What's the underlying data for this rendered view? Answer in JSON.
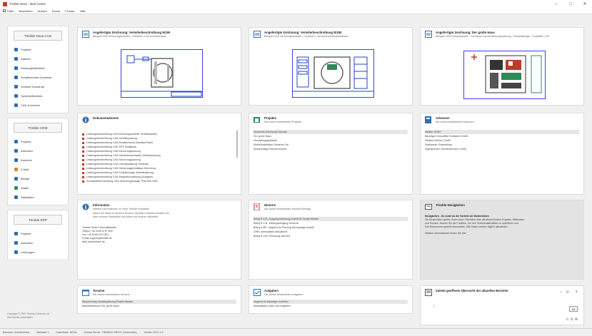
{
  "window": {
    "title": "Trimble Nova - Start Center",
    "minimize_glyph": "–",
    "maximize_glyph": "□",
    "close_glyph": "✕"
  },
  "menu": [
    "Datei",
    "Bearbeiten",
    "Ansicht",
    "Extras",
    "Fenster",
    "Hilfe"
  ],
  "sidebar": {
    "groups": [
      {
        "header": "Trimble Nova CAD",
        "items": [
          {
            "label": "Projekte",
            "icon": "folder-icon",
            "color": "blue"
          },
          {
            "label": "Dateien",
            "icon": "file-icon",
            "color": "blue"
          },
          {
            "label": "Planungsbibliothek",
            "icon": "library-icon",
            "color": "blue"
          },
          {
            "label": "Schaltschrank-Konstrukt",
            "icon": "cabinet-icon",
            "color": "blue"
          },
          {
            "label": "Verteiler-Konstrukt",
            "icon": "distributor-icon",
            "color": "blue"
          },
          {
            "label": "Symbolbibliothek",
            "icon": "symbol-icon",
            "color": "blue"
          },
          {
            "label": "CAD-Konverter",
            "icon": "converter-icon",
            "color": "blue"
          }
        ]
      },
      {
        "header": "Trimble CRM",
        "items": [
          {
            "label": "Projekte",
            "icon": "folder-icon",
            "color": "blue"
          },
          {
            "label": "Adressen",
            "icon": "address-icon",
            "color": "blue"
          },
          {
            "label": "Kalender",
            "icon": "calendar-icon",
            "color": "blue"
          },
          {
            "label": "E-Mail",
            "icon": "mail-icon",
            "color": "orange"
          },
          {
            "label": "Belege",
            "icon": "receipt-icon",
            "color": "blue"
          },
          {
            "label": "Artikel",
            "icon": "article-icon",
            "color": "green"
          },
          {
            "label": "Statistiken",
            "icon": "statistics-icon",
            "color": "blue"
          }
        ]
      },
      {
        "header": "Trimble ERP",
        "items": [
          {
            "label": "Projekte",
            "icon": "folder-icon",
            "color": "blue"
          },
          {
            "label": "Adressen",
            "icon": "address-icon",
            "color": "blue"
          },
          {
            "label": "Leistungen",
            "icon": "services-icon",
            "color": "blue"
          }
        ]
      }
    ],
    "footer": [
      "Copyright © 2021 Trimble Solutions Ltd.",
      "Alle Rechte vorbehalten."
    ]
  },
  "tiles": {
    "drawing1": {
      "title": "Angefertigte Zeichnung: Verteilerbeschreibung W150",
      "sub": "Beispiel CAD-Wohnungsverteiler - Gebäude 1 mit Schaltschrank"
    },
    "drawing2": {
      "title": "Angefertigte Zeichnung: Verteilerbeschreibung W150",
      "sub": "Beispiel CAD-Wohnungsverteiler - Laufwerk 1 mit Sicherheitsmaßnahmen"
    },
    "drawing3": {
      "title": "Angefertigte Zeichnung: Der große Haus",
      "sub": "Beispiel CAD-Gebäudepläne - Grundriss und Ausführungsplanung - Gesamtanlage - Projektfile 1:50"
    },
    "docs": {
      "title": "Dokumentationen",
      "items": [
        "Leistungsbeschreibung CAD-Wohnungsverteiler Verteilerkasten",
        "Leistungsbeschreibung CAD-Verteilerplanung",
        "Leistungsbeschreibung CAD-Schaltschrank-Standard-Paket",
        "Leistungsbeschreibung CAD-SPS Schaltplan",
        "Leistungsbeschreibung CAD-Steuerungsplanung",
        "Leistungsbeschreibung CAD-Gebäudeautomation Verteilerplanung",
        "Leistungsbeschreibung CAD-Steuerungsplanung",
        "Leistungsbeschreibung CAD-Leitungsplanung Gebäude",
        "Leistungsbeschreibung CAD-Steuerungsschaltplan-Zeichnung",
        "Leistungsbeschreibung CAD-Projektvorlage Verteilerplanung",
        "Leistungsbeschreibung CAD-Integrationsplanung (Ausgabe)",
        "Schaltplanbeschreibung CAD-Steuerungsanlage TRIA 500-1000"
      ]
    },
    "projects": {
      "title": "Projekte",
      "sub": "Die zuletzt bearbeiteten Projekte",
      "items": [
        "Musterbau Wohnung Fassade",
        "Der große Haus",
        "Verwaltungsgebäude",
        "Elektroinstallation Gewerbe Ost",
        "Musteranlage Rechenzentrum"
      ]
    },
    "addresses": {
      "title": "Adressen",
      "sub": "Die zuletzt bearbeiteten Adressen",
      "items": [
        "Meister GmbH",
        "Bauträger Immobilien Nordwest GmbH",
        "Meisters Elektro GmbH",
        "Stadtwerke Ostseeküste",
        "Ingenieurbüro Schneidermann GmbH"
      ]
    },
    "info": {
      "title": "Information",
      "lines": [
        "Weitere Informationen zu Ihren Trimble Produkten",
        "finden Sie direkt im Bereich Service. Aktuelle Hinweise erhalten Sie",
        "über unseren Newsletter und direkt auf unserer Webseite."
      ],
      "contact": [
        "Trimble GmbH Geschäftsstelle",
        "Telefon   +49 2045 6707-800",
        "Fax        +49 2045 6707-801",
        "E-Mail   support@trimble.de",
        "Web       www.trimble.de"
      ]
    },
    "history": {
      "title": "Historie",
      "sub": "Die zuletzt bearbeiteten Historie-Einträge",
      "items": [
        "Beleg R-123, Ausgangsrechnung erstellt für Kunde Meister",
        "Beleg R-124, Zahlungseingang verbucht",
        "Beleg A-087, Angebot für Planung Wohnanlage erstellt",
        "CRM: Adressdaten aktualisiert",
        "Beleg R-125, Rechnung storniert"
      ]
    },
    "news": {
      "title": "Trimble Neuigkeiten",
      "headline": "Neuigkeiten - So nutzt du die Vorteile der Bestenlisten",
      "body": [
        "Die Bestenlisten geben Ihnen einen Überblick über die aktuell besten Projekte, Mitarbeiter",
        "und Kunden. Nutzen Sie die Funktion, um Ihre Vertriebsaktivitäten zu optimieren und",
        "Ihre Ressourcen gezielt einzusetzen. Alle Daten werden täglich aktualisiert."
      ],
      "footer": "Weitere Informationen finden Sie hier"
    },
    "tasks": {
      "title": "Termine",
      "sub": "Die zuletzt bearbeiteten Termine",
      "items": [
        "Besprechung Verteilerplanung Projekt Meister",
        "Baustellentermin Der große Haus"
      ]
    },
    "todos": {
      "title": "Aufgaben",
      "sub": "Die zuletzt bearbeiteten Aufgaben",
      "items": [
        "Angebot für Bauträger erstellen",
        "Materialliste prüfen und freigeben"
      ]
    },
    "search": {
      "title": "Zuletzt geöffnete Übersicht der aktuellen Berichte",
      "value": "10"
    }
  },
  "statusbar": [
    "Benutzer: Administrator",
    "Mandant 1",
    "Datenbank: NOVA",
    "Zentral-Server: TRIMBLE-SRV01 (Verbunden)",
    "Version 2021.1.0"
  ]
}
